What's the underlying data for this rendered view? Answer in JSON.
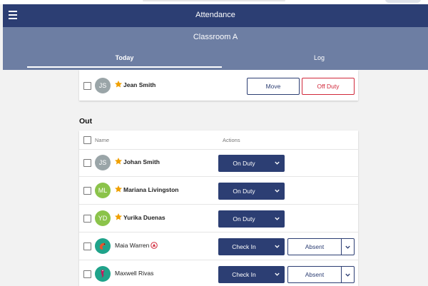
{
  "app": {
    "title": "Attendance"
  },
  "classroom": {
    "title": "Classroom A"
  },
  "tabs": [
    {
      "label": "Today",
      "active": true
    },
    {
      "label": "Log",
      "active": false
    }
  ],
  "colors": {
    "primary": "#2c3e73",
    "header_secondary": "#6d7ea3",
    "danger": "#d1283a",
    "star": "#f0a000"
  },
  "present_row": {
    "initials": "JS",
    "name": "Jean Smith",
    "avatar_color": "#9aa5a8",
    "move_label": "Move",
    "offduty_label": "Off Duty"
  },
  "out_section": {
    "title": "Out",
    "columns": {
      "name": "Name",
      "actions": "Actions"
    },
    "rows": [
      {
        "initials": "JS",
        "name": "Johan Smith",
        "avatar_color": "#9aa5a8",
        "starred": true,
        "action": "On Duty"
      },
      {
        "initials": "ML",
        "name": "Mariana Livingston",
        "avatar_color": "#8bc34a",
        "starred": true,
        "action": "On Duty"
      },
      {
        "initials": "YD",
        "name": "Yurika Duenas",
        "avatar_color": "#8bc34a",
        "starred": true,
        "action": "On Duty"
      },
      {
        "initials": "",
        "name": "Maia Warren",
        "avatar_color": "#1fa38a",
        "avatar_icon": "shrimp-icon",
        "alert_icon": "warning-icon",
        "action": "Check In",
        "secondary": "Absent"
      },
      {
        "initials": "",
        "name": "Maxwell Rivas",
        "avatar_color": "#1fa38a",
        "avatar_icon": "seahorse-icon",
        "action": "Check In",
        "secondary": "Absent"
      }
    ]
  }
}
